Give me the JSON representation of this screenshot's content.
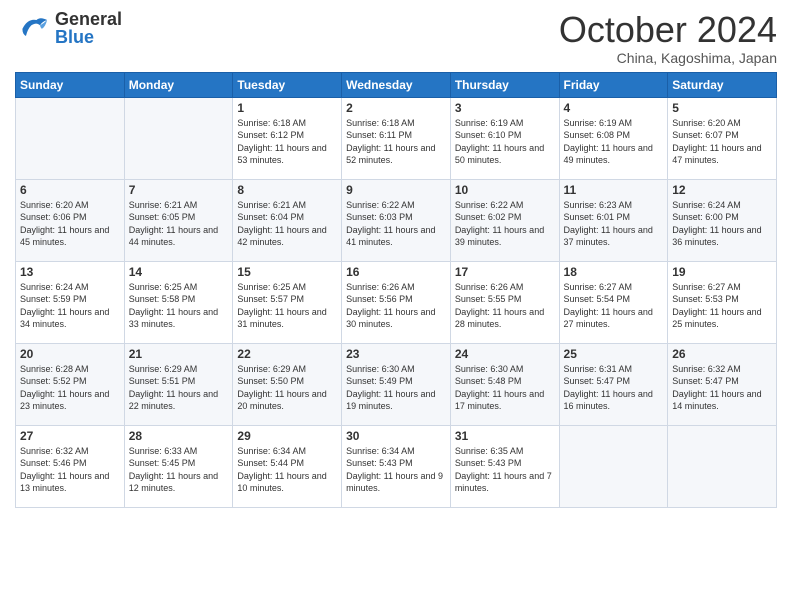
{
  "header": {
    "logo_general": "General",
    "logo_blue": "Blue",
    "month": "October 2024",
    "location": "China, Kagoshima, Japan"
  },
  "days_of_week": [
    "Sunday",
    "Monday",
    "Tuesday",
    "Wednesday",
    "Thursday",
    "Friday",
    "Saturday"
  ],
  "weeks": [
    [
      {
        "day": "",
        "info": ""
      },
      {
        "day": "",
        "info": ""
      },
      {
        "day": "1",
        "sunrise": "Sunrise: 6:18 AM",
        "sunset": "Sunset: 6:12 PM",
        "daylight": "Daylight: 11 hours and 53 minutes."
      },
      {
        "day": "2",
        "sunrise": "Sunrise: 6:18 AM",
        "sunset": "Sunset: 6:11 PM",
        "daylight": "Daylight: 11 hours and 52 minutes."
      },
      {
        "day": "3",
        "sunrise": "Sunrise: 6:19 AM",
        "sunset": "Sunset: 6:10 PM",
        "daylight": "Daylight: 11 hours and 50 minutes."
      },
      {
        "day": "4",
        "sunrise": "Sunrise: 6:19 AM",
        "sunset": "Sunset: 6:08 PM",
        "daylight": "Daylight: 11 hours and 49 minutes."
      },
      {
        "day": "5",
        "sunrise": "Sunrise: 6:20 AM",
        "sunset": "Sunset: 6:07 PM",
        "daylight": "Daylight: 11 hours and 47 minutes."
      }
    ],
    [
      {
        "day": "6",
        "sunrise": "Sunrise: 6:20 AM",
        "sunset": "Sunset: 6:06 PM",
        "daylight": "Daylight: 11 hours and 45 minutes."
      },
      {
        "day": "7",
        "sunrise": "Sunrise: 6:21 AM",
        "sunset": "Sunset: 6:05 PM",
        "daylight": "Daylight: 11 hours and 44 minutes."
      },
      {
        "day": "8",
        "sunrise": "Sunrise: 6:21 AM",
        "sunset": "Sunset: 6:04 PM",
        "daylight": "Daylight: 11 hours and 42 minutes."
      },
      {
        "day": "9",
        "sunrise": "Sunrise: 6:22 AM",
        "sunset": "Sunset: 6:03 PM",
        "daylight": "Daylight: 11 hours and 41 minutes."
      },
      {
        "day": "10",
        "sunrise": "Sunrise: 6:22 AM",
        "sunset": "Sunset: 6:02 PM",
        "daylight": "Daylight: 11 hours and 39 minutes."
      },
      {
        "day": "11",
        "sunrise": "Sunrise: 6:23 AM",
        "sunset": "Sunset: 6:01 PM",
        "daylight": "Daylight: 11 hours and 37 minutes."
      },
      {
        "day": "12",
        "sunrise": "Sunrise: 6:24 AM",
        "sunset": "Sunset: 6:00 PM",
        "daylight": "Daylight: 11 hours and 36 minutes."
      }
    ],
    [
      {
        "day": "13",
        "sunrise": "Sunrise: 6:24 AM",
        "sunset": "Sunset: 5:59 PM",
        "daylight": "Daylight: 11 hours and 34 minutes."
      },
      {
        "day": "14",
        "sunrise": "Sunrise: 6:25 AM",
        "sunset": "Sunset: 5:58 PM",
        "daylight": "Daylight: 11 hours and 33 minutes."
      },
      {
        "day": "15",
        "sunrise": "Sunrise: 6:25 AM",
        "sunset": "Sunset: 5:57 PM",
        "daylight": "Daylight: 11 hours and 31 minutes."
      },
      {
        "day": "16",
        "sunrise": "Sunrise: 6:26 AM",
        "sunset": "Sunset: 5:56 PM",
        "daylight": "Daylight: 11 hours and 30 minutes."
      },
      {
        "day": "17",
        "sunrise": "Sunrise: 6:26 AM",
        "sunset": "Sunset: 5:55 PM",
        "daylight": "Daylight: 11 hours and 28 minutes."
      },
      {
        "day": "18",
        "sunrise": "Sunrise: 6:27 AM",
        "sunset": "Sunset: 5:54 PM",
        "daylight": "Daylight: 11 hours and 27 minutes."
      },
      {
        "day": "19",
        "sunrise": "Sunrise: 6:27 AM",
        "sunset": "Sunset: 5:53 PM",
        "daylight": "Daylight: 11 hours and 25 minutes."
      }
    ],
    [
      {
        "day": "20",
        "sunrise": "Sunrise: 6:28 AM",
        "sunset": "Sunset: 5:52 PM",
        "daylight": "Daylight: 11 hours and 23 minutes."
      },
      {
        "day": "21",
        "sunrise": "Sunrise: 6:29 AM",
        "sunset": "Sunset: 5:51 PM",
        "daylight": "Daylight: 11 hours and 22 minutes."
      },
      {
        "day": "22",
        "sunrise": "Sunrise: 6:29 AM",
        "sunset": "Sunset: 5:50 PM",
        "daylight": "Daylight: 11 hours and 20 minutes."
      },
      {
        "day": "23",
        "sunrise": "Sunrise: 6:30 AM",
        "sunset": "Sunset: 5:49 PM",
        "daylight": "Daylight: 11 hours and 19 minutes."
      },
      {
        "day": "24",
        "sunrise": "Sunrise: 6:30 AM",
        "sunset": "Sunset: 5:48 PM",
        "daylight": "Daylight: 11 hours and 17 minutes."
      },
      {
        "day": "25",
        "sunrise": "Sunrise: 6:31 AM",
        "sunset": "Sunset: 5:47 PM",
        "daylight": "Daylight: 11 hours and 16 minutes."
      },
      {
        "day": "26",
        "sunrise": "Sunrise: 6:32 AM",
        "sunset": "Sunset: 5:47 PM",
        "daylight": "Daylight: 11 hours and 14 minutes."
      }
    ],
    [
      {
        "day": "27",
        "sunrise": "Sunrise: 6:32 AM",
        "sunset": "Sunset: 5:46 PM",
        "daylight": "Daylight: 11 hours and 13 minutes."
      },
      {
        "day": "28",
        "sunrise": "Sunrise: 6:33 AM",
        "sunset": "Sunset: 5:45 PM",
        "daylight": "Daylight: 11 hours and 12 minutes."
      },
      {
        "day": "29",
        "sunrise": "Sunrise: 6:34 AM",
        "sunset": "Sunset: 5:44 PM",
        "daylight": "Daylight: 11 hours and 10 minutes."
      },
      {
        "day": "30",
        "sunrise": "Sunrise: 6:34 AM",
        "sunset": "Sunset: 5:43 PM",
        "daylight": "Daylight: 11 hours and 9 minutes."
      },
      {
        "day": "31",
        "sunrise": "Sunrise: 6:35 AM",
        "sunset": "Sunset: 5:43 PM",
        "daylight": "Daylight: 11 hours and 7 minutes."
      },
      {
        "day": "",
        "info": ""
      },
      {
        "day": "",
        "info": ""
      }
    ]
  ]
}
